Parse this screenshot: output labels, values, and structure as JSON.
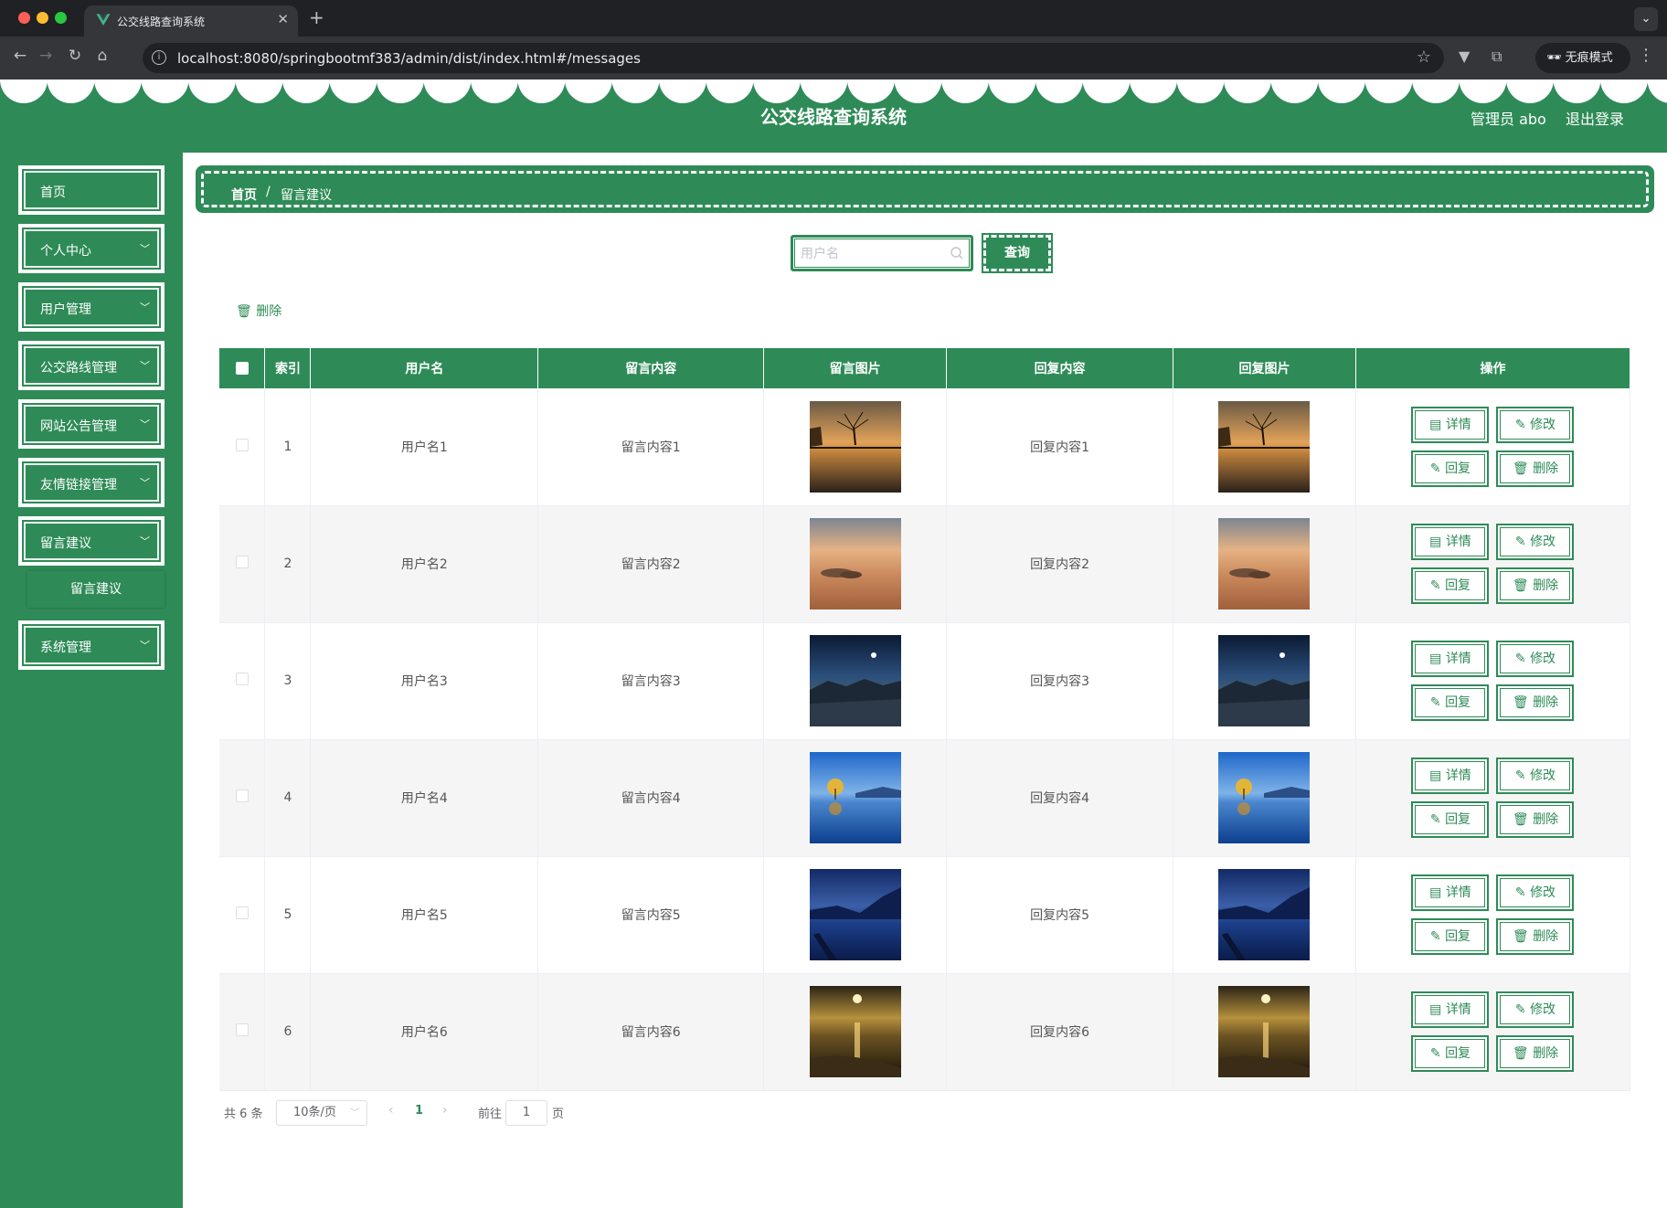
{
  "browser": {
    "tab_title": "公交线路查询系统",
    "url": "localhost:8080/springbootmf383/admin/dist/index.html#/messages",
    "incognito_label": "无痕模式"
  },
  "header": {
    "title": "公交线路查询系统",
    "admin": "管理员 abo",
    "logout": "退出登录"
  },
  "sidebar": {
    "items": [
      {
        "label": "首页",
        "has_children": false
      },
      {
        "label": "个人中心",
        "has_children": true
      },
      {
        "label": "用户管理",
        "has_children": true
      },
      {
        "label": "公交路线管理",
        "has_children": true
      },
      {
        "label": "网站公告管理",
        "has_children": true
      },
      {
        "label": "友情链接管理",
        "has_children": true
      },
      {
        "label": "留言建议",
        "has_children": true
      },
      {
        "label": "系统管理",
        "has_children": true
      }
    ],
    "submenu": {
      "label": "留言建议"
    }
  },
  "breadcrumb": {
    "home": "首页",
    "separator": "/",
    "current": "留言建议"
  },
  "search": {
    "placeholder": "用户名",
    "button": "查询"
  },
  "actions": {
    "batch_delete": "删除"
  },
  "table": {
    "columns": [
      "索引",
      "用户名",
      "留言内容",
      "留言图片",
      "回复内容",
      "回复图片",
      "操作"
    ],
    "buttons": {
      "detail": "详情",
      "edit": "修改",
      "reply": "回复",
      "delete": "删除"
    },
    "rows": [
      {
        "index": "1",
        "username": "用户名1",
        "content": "留言内容1",
        "reply": "回复内容1",
        "image": "lake-tree-sunset"
      },
      {
        "index": "2",
        "username": "用户名2",
        "content": "留言内容2",
        "reply": "回复内容2",
        "image": "sunset-clouds"
      },
      {
        "index": "3",
        "username": "用户名3",
        "content": "留言内容3",
        "reply": "回复内容3",
        "image": "night-mountain-moon"
      },
      {
        "index": "4",
        "username": "用户名4",
        "content": "留言内容4",
        "reply": "回复内容4",
        "image": "blue-lake-tree"
      },
      {
        "index": "5",
        "username": "用户名5",
        "content": "留言内容5",
        "reply": "回复内容5",
        "image": "blue-fjord-dusk"
      },
      {
        "index": "6",
        "username": "用户名6",
        "content": "留言内容6",
        "reply": "回复内容6",
        "image": "golden-sea-sunset"
      }
    ]
  },
  "pagination": {
    "total": "共 6 条",
    "page_size": "10条/页",
    "current_page": "1",
    "goto_label": "前往",
    "goto_value": "1",
    "goto_unit": "页"
  },
  "colors": {
    "primary": "#2e8b57",
    "stripe": "#f5f5f5",
    "header_text": "#ffffff"
  }
}
